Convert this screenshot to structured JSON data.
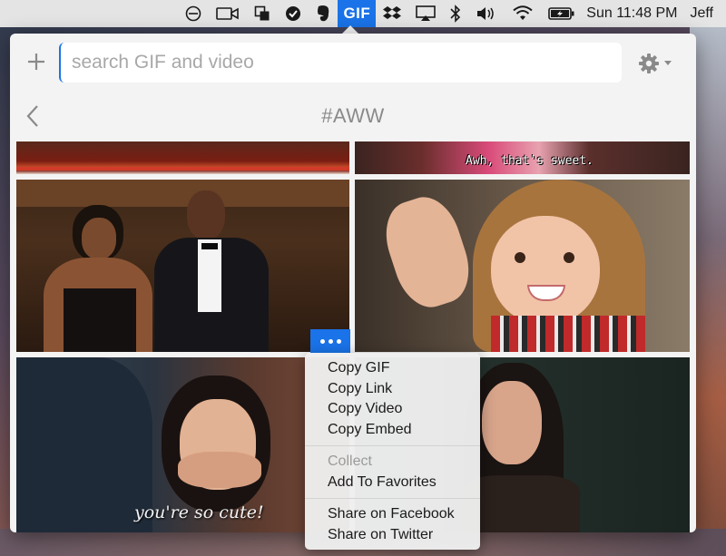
{
  "menubar": {
    "gif_label": "GIF",
    "clock": "Sun 11:48 PM",
    "user": "Jeff",
    "icons": [
      "do-not-disturb-icon",
      "video-camera-icon",
      "copy-windows-icon",
      "checkmark-circle-icon",
      "evernote-icon",
      "gif-app-icon",
      "dropbox-icon",
      "airplay-icon",
      "bluetooth-icon",
      "volume-icon",
      "wifi-icon",
      "battery-charging-icon"
    ]
  },
  "search": {
    "placeholder": "search GIF and video",
    "value": ""
  },
  "toolbar": {
    "add_icon": "plus-icon",
    "settings_icon": "gear-icon"
  },
  "header": {
    "back_icon": "chevron-left-icon",
    "title": "#AWW"
  },
  "gifs": [
    {
      "caption": ""
    },
    {
      "caption": "Awh, that's sweet."
    },
    {
      "caption": ""
    },
    {
      "caption": ""
    },
    {
      "caption": "you're so cute!"
    },
    {
      "caption": ""
    }
  ],
  "context_menu": {
    "copy_gif": "Copy GIF",
    "copy_link": "Copy Link",
    "copy_video": "Copy Video",
    "copy_embed": "Copy Embed",
    "collect_header": "Collect",
    "add_favorites": "Add To Favorites",
    "share_facebook": "Share on Facebook",
    "share_twitter": "Share on Twitter"
  },
  "colors": {
    "accent": "#1a73e8",
    "panel_bg": "#f3f3f3"
  }
}
